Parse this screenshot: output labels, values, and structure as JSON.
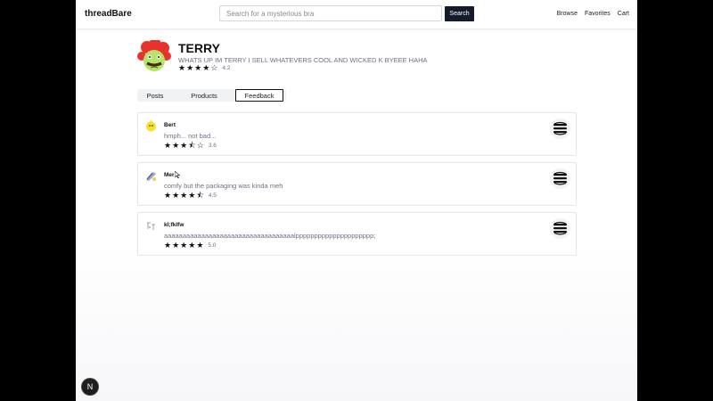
{
  "app": {
    "brand": "threadBare"
  },
  "search": {
    "placeholder": "Search for a mysterious bra",
    "value": "",
    "button_label": "Search"
  },
  "nav": {
    "links": [
      "Browse",
      "Favorites",
      "Cart"
    ]
  },
  "profile": {
    "name": "TERRY",
    "bio": "WHATS UP IM TERRY I SELL WHATEVERS COOL AND WICKED K BYEEE HAHA",
    "rating": "4.2",
    "stars": 4.2
  },
  "tabs": [
    {
      "label": "Posts",
      "active": false
    },
    {
      "label": "Products",
      "active": false
    },
    {
      "label": "Feedback",
      "active": true
    }
  ],
  "feedback": [
    {
      "name": "Bert",
      "text": "hmph... not bad...",
      "rating": "3.6",
      "stars": 3.6
    },
    {
      "name": "Mer",
      "text": "comfy but the packaging was kinda meh",
      "rating": "4.5",
      "stars": 4.5
    },
    {
      "name": "kl;fklfw",
      "text": "aaaaaaaaaaaaaaaaaaaaaaaaaaaaaaaaaaalppppppppppppppppppppp;",
      "rating": "5.0",
      "stars": 5.0
    }
  ],
  "badge": {
    "label": "N"
  },
  "icons": {
    "star_full": "★",
    "star_half": "⯪",
    "star_empty": "☆"
  },
  "colors": {
    "accent": "#141b2b",
    "muted_text": "#6b7280",
    "avatar_red": "#e8322c",
    "avatar_green": "#b6e36b"
  }
}
